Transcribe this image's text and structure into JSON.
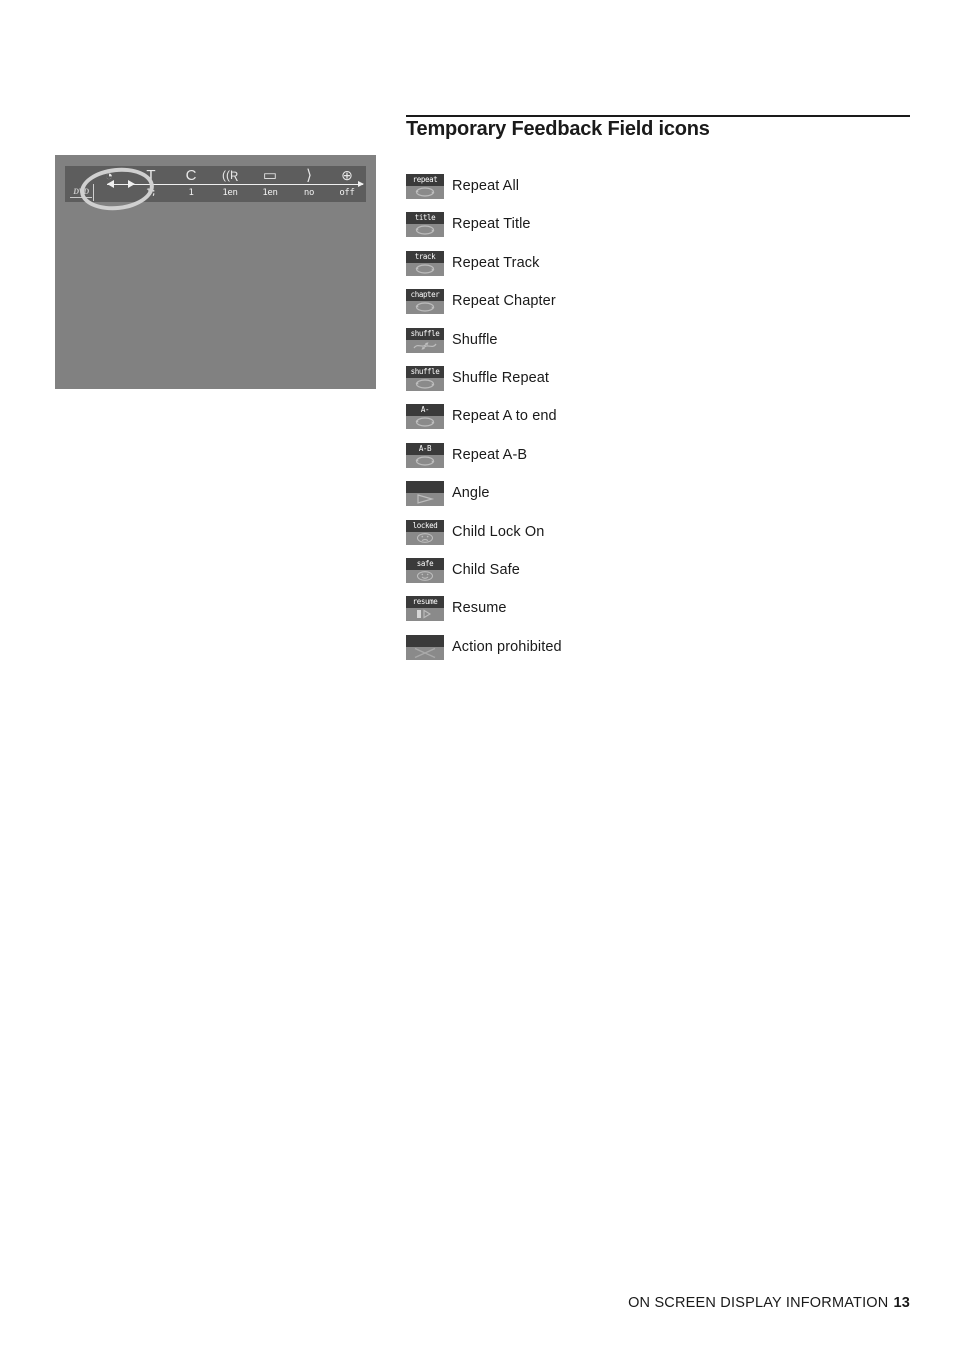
{
  "section": {
    "title": "Temporary Feedback Field icons"
  },
  "tv_screen": {
    "name": "dvd-on-screen-display-illustration",
    "disc_logo": "DVD",
    "osd_fields": [
      {
        "glyph_name": "disc-icon",
        "glyph": "◔",
        "value": ""
      },
      {
        "glyph_name": "title-icon",
        "glyph": "T",
        "value": "1;"
      },
      {
        "glyph_name": "chapter-icon",
        "glyph": "C",
        "value": "1"
      },
      {
        "glyph_name": "audio-language-icon",
        "glyph": "((Ʀ",
        "value": "1en"
      },
      {
        "glyph_name": "subtitle-icon",
        "glyph": "▭",
        "value": "1en"
      },
      {
        "glyph_name": "angle-icon",
        "glyph": "⟩",
        "value": "no"
      },
      {
        "glyph_name": "zoom-icon",
        "glyph": "⊕",
        "value": "off"
      }
    ]
  },
  "icons": [
    {
      "cap": "repeat",
      "symbol": "repeat-loop",
      "label": "Repeat All"
    },
    {
      "cap": "title",
      "symbol": "repeat-loop",
      "label": "Repeat Title"
    },
    {
      "cap": "track",
      "symbol": "repeat-loop",
      "label": "Repeat Track"
    },
    {
      "cap": "chapter",
      "symbol": "repeat-loop",
      "label": "Repeat Chapter"
    },
    {
      "cap": "shuffle",
      "symbol": "shuffle-arrows",
      "label": "Shuffle"
    },
    {
      "cap": "shuffle",
      "symbol": "repeat-loop",
      "label": "Shuffle Repeat"
    },
    {
      "cap": "A-",
      "symbol": "repeat-loop",
      "label": "Repeat A to end"
    },
    {
      "cap": "A-B",
      "symbol": "repeat-loop",
      "label": "Repeat A-B"
    },
    {
      "cap": "",
      "symbol": "angle-triangle",
      "label": "Angle"
    },
    {
      "cap": "locked",
      "symbol": "sad-face",
      "label": "Child Lock On"
    },
    {
      "cap": "safe",
      "symbol": "happy-face",
      "label": "Child Safe"
    },
    {
      "cap": "resume",
      "symbol": "resume-play",
      "label": "Resume"
    },
    {
      "cap": "",
      "symbol": "cross-prohibited",
      "label": "Action prohibited"
    }
  ],
  "footer": {
    "chapter_title": "ON SCREEN DISPLAY INFORMATION",
    "page_number": "13"
  },
  "colors": {
    "screen_bg": "#818181",
    "osd_bar": "#5d5d5d",
    "icon_body": "#8a8a8a",
    "icon_cap": "#3a3a3a",
    "text": "#1a1a1a"
  }
}
